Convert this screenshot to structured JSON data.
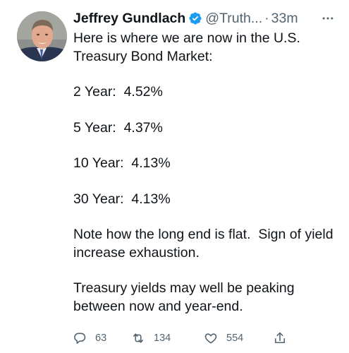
{
  "tweet": {
    "author_name": "Jeffrey Gundlach",
    "handle": "@Truth...",
    "separator": "·",
    "time": "33m",
    "body": [
      "Here is where we are now in the U.S. Treasury Bond Market:",
      "2 Year:  4.52%",
      "5 Year:  4.37%",
      "10 Year:  4.13%",
      "30 Year:  4.13%",
      "Note how the long end is flat.  Sign of yield increase exhaustion.",
      "Treasury yields may well be peaking between now and year-end."
    ],
    "actions": {
      "reply_count": "63",
      "retweet_count": "134",
      "like_count": "554"
    }
  },
  "icons": {
    "verified": "verified-badge-icon",
    "more": "more-horizontal-icon",
    "reply": "reply-icon",
    "retweet": "retweet-icon",
    "like": "heart-icon",
    "share": "share-icon"
  },
  "colors": {
    "text": "#0f1419",
    "secondary": "#536471",
    "verified_blue": "#1d9bf0"
  }
}
